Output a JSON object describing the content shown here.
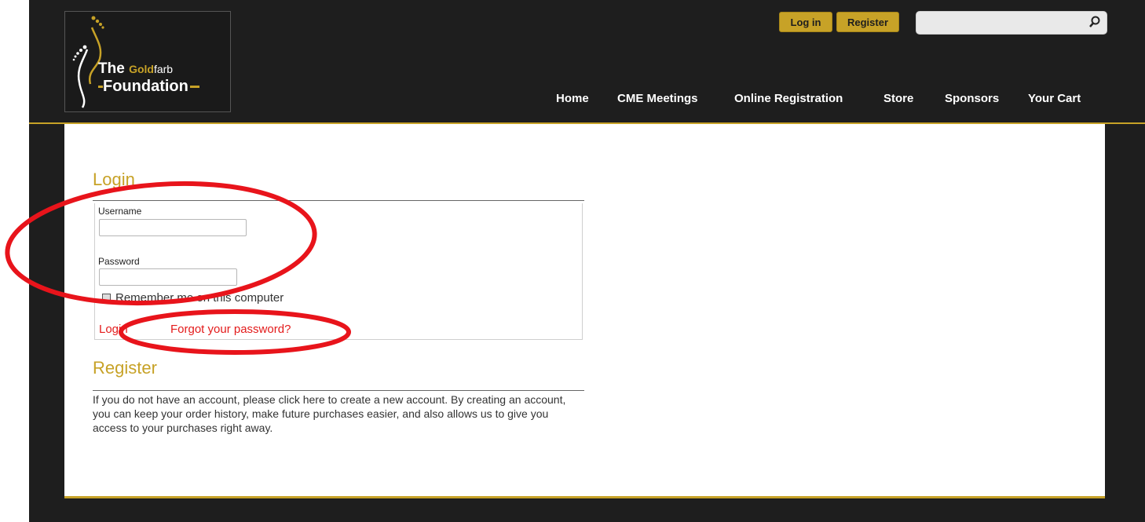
{
  "logo": {
    "the": "The",
    "gold": "Gold",
    "farb": "farb",
    "foundation": "Foundation"
  },
  "header": {
    "login_button": "Log in",
    "register_button": "Register",
    "search": {
      "placeholder": "",
      "icon": "search-icon"
    }
  },
  "nav": {
    "items": [
      {
        "label": "Home"
      },
      {
        "label": "CME Meetings"
      },
      {
        "label": "Online Registration"
      },
      {
        "label": "Store"
      },
      {
        "label": "Sponsors"
      },
      {
        "label": "Your Cart"
      }
    ]
  },
  "login": {
    "heading": "Login",
    "username_label": "Username",
    "username_value": "",
    "password_label": "Password",
    "password_value": "",
    "remember_label": "Remember me on this computer",
    "remember_checked": false,
    "login_link": "Login",
    "forgot_link": "Forgot your password?"
  },
  "register": {
    "heading": "Register",
    "text": "If you do not have an account, please click here to create a new account.  By creating an account, you can keep your order history, make future purchases easier, and also allows us to give you access to your purchases right away."
  },
  "colors": {
    "accent_gold": "#c7a227",
    "background_dark": "#1e1e1e",
    "link_red": "#e31b1b",
    "annotation_red": "#e8141b"
  }
}
